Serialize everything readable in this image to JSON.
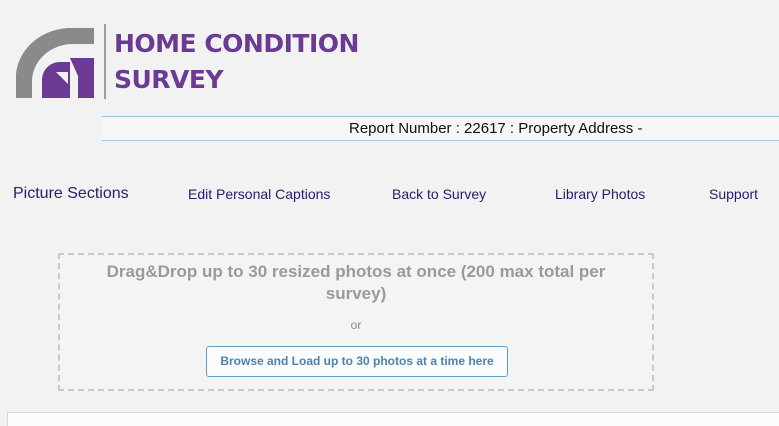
{
  "logo": {
    "line1": "HOME CONDITION",
    "line2": "SURVEY",
    "mark_icon": "home-condition-survey-logo-mark",
    "brand_color": "#6b3a93",
    "mark_color": "#8a8a8a"
  },
  "report": {
    "text": "Report Number : 22617 : Property Address -"
  },
  "nav": {
    "items": [
      {
        "label": "Picture Sections"
      },
      {
        "label": "Edit Personal Captions"
      },
      {
        "label": "Back to Survey"
      },
      {
        "label": "Library Photos"
      },
      {
        "label": "Support"
      }
    ]
  },
  "dropzone": {
    "title": "Drag&Drop up to 30 resized photos at once (200 max total per survey)",
    "or_text": "or",
    "browse_label": "Browse and Load up to 30 photos at a time here"
  }
}
